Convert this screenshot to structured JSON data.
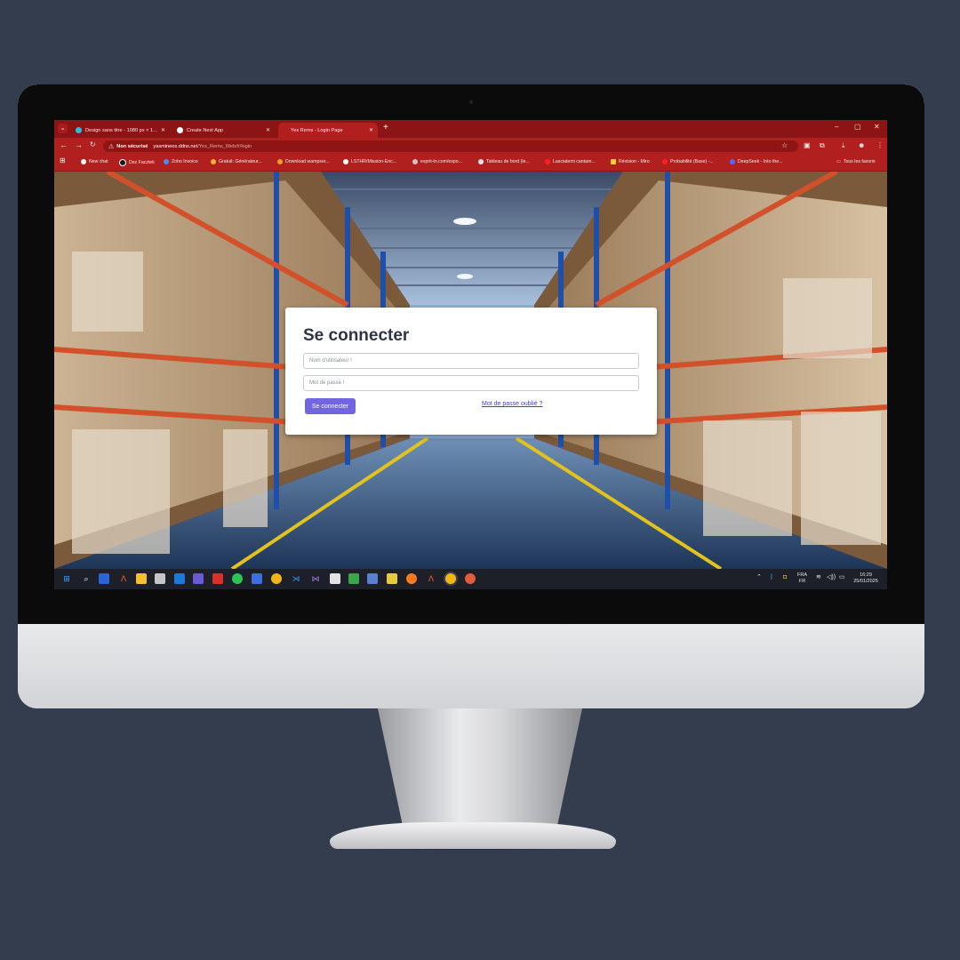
{
  "browser": {
    "tabs": [
      {
        "label": "Design sans titre - 1080 px × 1…",
        "active": false
      },
      {
        "label": "Create Next App",
        "active": false
      },
      {
        "label": "Yes Rems - Login Page",
        "active": true
      }
    ],
    "new_tab_symbol": "+",
    "window_controls": [
      "–",
      "▢",
      "✕"
    ],
    "address": {
      "security_label": "Non sécurisé",
      "host": "yasminees.ddns.net",
      "path": "/Yes_Rems_Web/#/login"
    },
    "bookmarks": [
      {
        "label": "New chat",
        "color": "#ffffff"
      },
      {
        "label": "Dez Facztek",
        "color": "#1a1a1a"
      },
      {
        "label": "Zoho Invoice",
        "color": "#4a8cf0"
      },
      {
        "label": "Gratuit: Générateur...",
        "color": "#f0b43a"
      },
      {
        "label": "Download wampser...",
        "color": "#f0a020"
      },
      {
        "label": "LSTHR/Mission-Enc...",
        "color": "#ffffff"
      },
      {
        "label": "esprit-tn.com/espo...",
        "color": "#c8c8c8"
      },
      {
        "label": "Tableau de bord (le...",
        "color": "#e8e8e8"
      },
      {
        "label": "Lasciatemi cantare...",
        "color": "#ff2020"
      },
      {
        "label": "Révision - Miro",
        "color": "#ffd02a"
      },
      {
        "label": "Probabilité (Base) -...",
        "color": "#ff2020"
      },
      {
        "label": "DeepSeek - Into the...",
        "color": "#4d6bfe"
      }
    ],
    "all_bookmarks_label": "Tous les favoris"
  },
  "login": {
    "title": "Se connecter",
    "username_placeholder": "Nom d'utilisateur !",
    "password_placeholder": "Mot de passe !",
    "submit_label": "Se connecter",
    "forgot_link": "Mot de passe oublié ?"
  },
  "taskbar": {
    "language": "FRA",
    "layout": "FR",
    "time": "16:29",
    "date": "25/01/2025"
  },
  "colors": {
    "browser_accent": "#b21f1f",
    "button": "#7165e2",
    "link": "#3b3fcf",
    "desktop_bg": "#343d4e"
  }
}
